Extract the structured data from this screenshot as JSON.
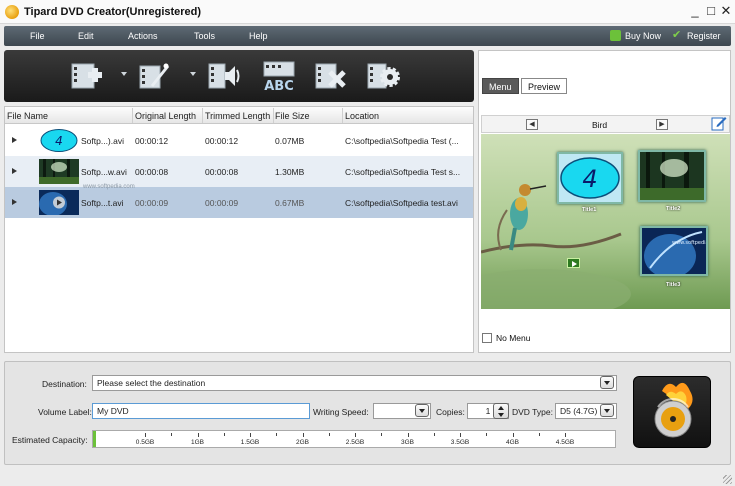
{
  "window": {
    "title": "Tipard DVD Creator(Unregistered)",
    "controls": {
      "minimize": "_",
      "maximize": "□",
      "close": "✕"
    }
  },
  "menubar": {
    "items": [
      "File",
      "Edit",
      "Actions",
      "Tools",
      "Help"
    ],
    "buy_now": "Buy Now",
    "register": "Register"
  },
  "toolbar": {
    "icons": [
      "add-file-icon",
      "edit-video-icon",
      "audio-icon",
      "subtitle-icon",
      "remove-icon",
      "settings-icon"
    ]
  },
  "file_list": {
    "columns": [
      "File Name",
      "Original Length",
      "Trimmed Length",
      "File Size",
      "Location"
    ],
    "rows": [
      {
        "name": "Softp...).avi",
        "original": "00:00:12",
        "trimmed": "00:00:12",
        "size": "0.07MB",
        "location": "C:\\softpedia\\Softpedia Test (..."
      },
      {
        "name": "Softp...w.avi",
        "original": "00:00:08",
        "trimmed": "00:00:08",
        "size": "1.30MB",
        "location": "C:\\softpedia\\Softpedia Test s..."
      },
      {
        "name": "Softp...t.avi",
        "original": "00:00:09",
        "trimmed": "00:00:09",
        "size": "0.67MB",
        "location": "C:\\softpedia\\Softpedia test.avi"
      }
    ],
    "watermark": "www.softpedia.com"
  },
  "preview": {
    "tabs": [
      "Menu",
      "Preview"
    ],
    "template_name": "Bird",
    "titles": [
      "Title1",
      "Title2",
      "Title3"
    ],
    "no_menu_label": "No Menu",
    "thumb_text": "4"
  },
  "bottom": {
    "destination_label": "Destination:",
    "destination_placeholder": "Please select the destination",
    "volume_label": "Volume Label:",
    "volume_value": "My DVD",
    "writing_speed_label": "Writing Speed:",
    "writing_speed_value": "",
    "copies_label": "Copies:",
    "copies_value": "1",
    "dvd_type_label": "DVD Type:",
    "dvd_type_value": "D5 (4.7G)",
    "capacity_label": "Estimated Capacity:",
    "capacity_ticks": [
      "0.5GB",
      "1GB",
      "1.5GB",
      "2GB",
      "2.5GB",
      "3GB",
      "3.5GB",
      "4GB",
      "4.5GB"
    ]
  },
  "colors": {
    "menubar_bg": "#4a555e",
    "selected_row": "#b9cbe0",
    "alt_row": "#e8eef5",
    "accent_green": "#6cc13a"
  }
}
